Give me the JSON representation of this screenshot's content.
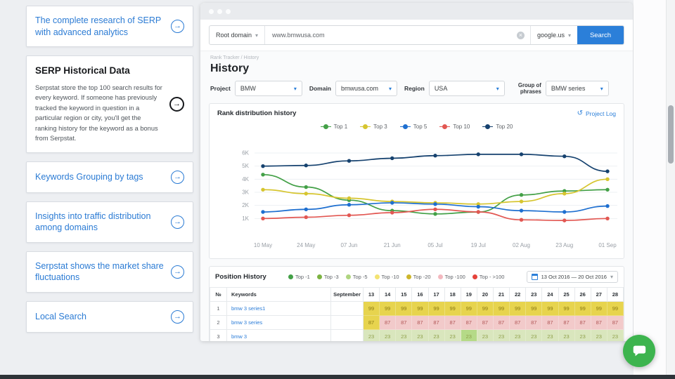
{
  "sidebar": {
    "cards": [
      {
        "title": "The complete research of SERP with advanced analytics"
      },
      {
        "title": "SERP Historical Data",
        "description": "Serpstat store the top 100 search results for every keyword. If someone has previously tracked the keyword in question in a particular region or city, you'll get the ranking history for the keyword as a bonus from Serpstat."
      },
      {
        "title": "Keywords Grouping by tags"
      },
      {
        "title": "Insights into traffic distribution among domains"
      },
      {
        "title": "Serpstat shows the market share fluctuations"
      },
      {
        "title": "Local Search"
      }
    ]
  },
  "app": {
    "searchbar": {
      "scope": "Root domain",
      "query": "www.bmwusa.com",
      "engine": "google.us",
      "button": "Search"
    },
    "breadcrumb": "Rank Tracker / History",
    "title": "History",
    "filters": [
      {
        "label": "Project",
        "value": "BMW"
      },
      {
        "label": "Domain",
        "value": "bmwusa.com"
      },
      {
        "label": "Region",
        "value": "USA"
      },
      {
        "label": "Group of phrases",
        "value": "BMW series"
      }
    ],
    "rank_section": {
      "title": "Rank distribution history",
      "project_log": "Project Log"
    },
    "position_section": {
      "title": "Position History",
      "legend": [
        {
          "label": "Top -1",
          "color": "#43a047"
        },
        {
          "label": "Top -3",
          "color": "#7cb342"
        },
        {
          "label": "Top -5",
          "color": "#afd580"
        },
        {
          "label": "Top -10",
          "color": "#f3e372"
        },
        {
          "label": "Top -20",
          "color": "#cdb62c"
        },
        {
          "label": "Top -100",
          "color": "#f3b8bf"
        },
        {
          "label": "Top - >100",
          "color": "#e5433b"
        }
      ],
      "date_range": "13 Oct 2016 — 20 Oct 2016",
      "table": {
        "columns": [
          "№",
          "Keywords",
          "September",
          "13",
          "14",
          "15",
          "16",
          "17",
          "18",
          "19",
          "20",
          "21",
          "22",
          "23",
          "24",
          "25",
          "26",
          "27",
          "28"
        ],
        "rows": [
          {
            "num": "1",
            "keyword": "bmw 3 series1",
            "september": "",
            "values": [
              "99",
              "99",
              "99",
              "99",
              "99",
              "99",
              "99",
              "99",
              "99",
              "99",
              "99",
              "99",
              "99",
              "99",
              "99",
              "99"
            ],
            "colors": [
              "y",
              "y",
              "y",
              "y",
              "y",
              "y",
              "y",
              "y",
              "y",
              "y",
              "y",
              "y",
              "y",
              "y",
              "y",
              "y"
            ]
          },
          {
            "num": "2",
            "keyword": "bmw 3 series",
            "september": "",
            "values": [
              "87",
              "87",
              "87",
              "87",
              "87",
              "87",
              "87",
              "87",
              "87",
              "87",
              "87",
              "87",
              "87",
              "87",
              "87",
              "87"
            ],
            "colors": [
              "y",
              "p",
              "p",
              "p",
              "p",
              "p",
              "p",
              "p",
              "p",
              "p",
              "p",
              "p",
              "p",
              "p",
              "p",
              "p"
            ]
          },
          {
            "num": "3",
            "keyword": "bmw 3",
            "september": "",
            "values": [
              "23",
              "23",
              "23",
              "23",
              "23",
              "23",
              "23",
              "23",
              "23",
              "23",
              "23",
              "23",
              "23",
              "23",
              "23",
              "23"
            ],
            "colors": [
              "g",
              "g",
              "g",
              "g",
              "g",
              "g",
              "gh",
              "g",
              "g",
              "g",
              "g",
              "g",
              "g",
              "g",
              "g",
              "g"
            ]
          }
        ]
      }
    }
  },
  "chart_data": {
    "type": "line",
    "title": "Rank distribution history",
    "x": [
      "10 May",
      "24 May",
      "07 Jun",
      "21 Jun",
      "05 Jul",
      "19 Jul",
      "02 Aug",
      "23 Aug",
      "01 Sep"
    ],
    "ylim": [
      0,
      6500
    ],
    "yticks": [
      1000,
      2000,
      3000,
      4000,
      5000,
      6000
    ],
    "ytick_labels": [
      "1K",
      "2K",
      "3K",
      "4K",
      "5K",
      "6K"
    ],
    "grid": "horizontal",
    "legend_position": "top",
    "series": [
      {
        "name": "Top 1",
        "color": "#43a047",
        "values": [
          4350,
          3400,
          2400,
          1600,
          1350,
          1500,
          2800,
          3100,
          3200
        ]
      },
      {
        "name": "Top 3",
        "color": "#d6c52f",
        "values": [
          3200,
          2900,
          2550,
          2300,
          2200,
          2100,
          2300,
          2900,
          4000
        ]
      },
      {
        "name": "Top 5",
        "color": "#1e6fd0",
        "values": [
          1500,
          1700,
          2050,
          2200,
          2100,
          1900,
          1600,
          1500,
          1950
        ]
      },
      {
        "name": "Top 10",
        "color": "#e25752",
        "values": [
          1000,
          1100,
          1250,
          1450,
          1700,
          1500,
          900,
          850,
          1000
        ]
      },
      {
        "name": "Top 20",
        "color": "#16426f",
        "values": [
          5000,
          5050,
          5400,
          5600,
          5800,
          5900,
          5900,
          5750,
          4600
        ]
      }
    ]
  }
}
